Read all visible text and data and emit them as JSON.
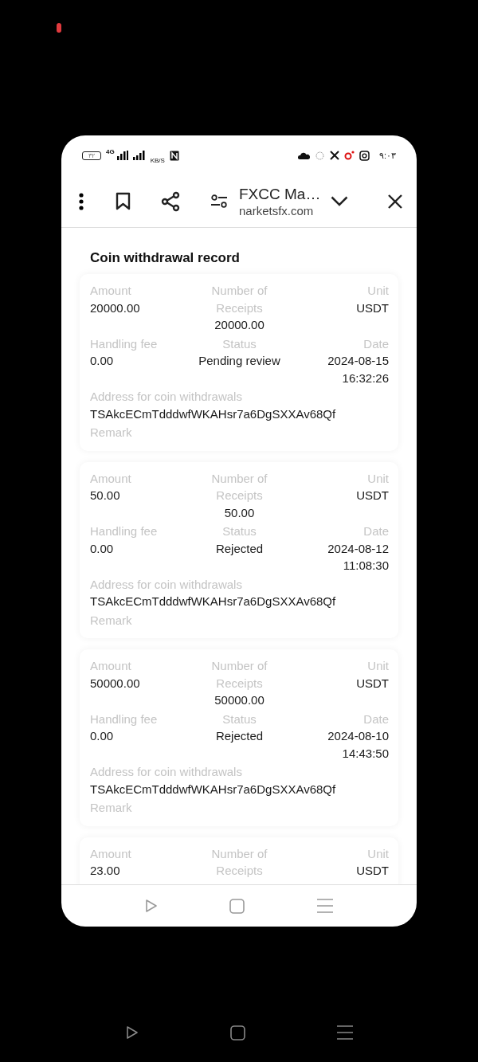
{
  "status_bar": {
    "battery": "٣٢",
    "network": "4G",
    "speed_unit": "KB/S",
    "time": "٩:٠٣"
  },
  "toolbar": {
    "title": "FXCC Ma…",
    "url": "narketsfx.com"
  },
  "page_title": "Coin withdrawal record",
  "records": [
    {
      "amount_label": "Amount",
      "amount": "20000.00",
      "receipts_label": "Number of Receipts",
      "receipts": "20000.00",
      "unit_label": "Unit",
      "unit": "USDT",
      "fee_label": "Handling fee",
      "fee": "0.00",
      "status_label": "Status",
      "status": "Pending review",
      "date_label": "Date",
      "date": "2024-08-15 16:32:26",
      "address_label": "Address for coin withdrawals",
      "address": "TSAkcECmTdddwfWKAHsr7a6DgSXXAv68Qf",
      "remark_label": "Remark"
    },
    {
      "amount_label": "Amount",
      "amount": "50.00",
      "receipts_label": "Number of Receipts",
      "receipts": "50.00",
      "unit_label": "Unit",
      "unit": "USDT",
      "fee_label": "Handling fee",
      "fee": "0.00",
      "status_label": "Status",
      "status": "Rejected",
      "date_label": "Date",
      "date": "2024-08-12 11:08:30",
      "address_label": "Address for coin withdrawals",
      "address": "TSAkcECmTdddwfWKAHsr7a6DgSXXAv68Qf",
      "remark_label": "Remark"
    },
    {
      "amount_label": "Amount",
      "amount": "50000.00",
      "receipts_label": "Number of Receipts",
      "receipts": "50000.00",
      "unit_label": "Unit",
      "unit": "USDT",
      "fee_label": "Handling fee",
      "fee": "0.00",
      "status_label": "Status",
      "status": "Rejected",
      "date_label": "Date",
      "date": "2024-08-10 14:43:50",
      "address_label": "Address for coin withdrawals",
      "address": "TSAkcECmTdddwfWKAHsr7a6DgSXXAv68Qf",
      "remark_label": "Remark"
    },
    {
      "amount_label": "Amount",
      "amount": "23.00",
      "receipts_label": "Number of Receipts",
      "unit_label": "Unit",
      "unit": "USDT"
    }
  ]
}
